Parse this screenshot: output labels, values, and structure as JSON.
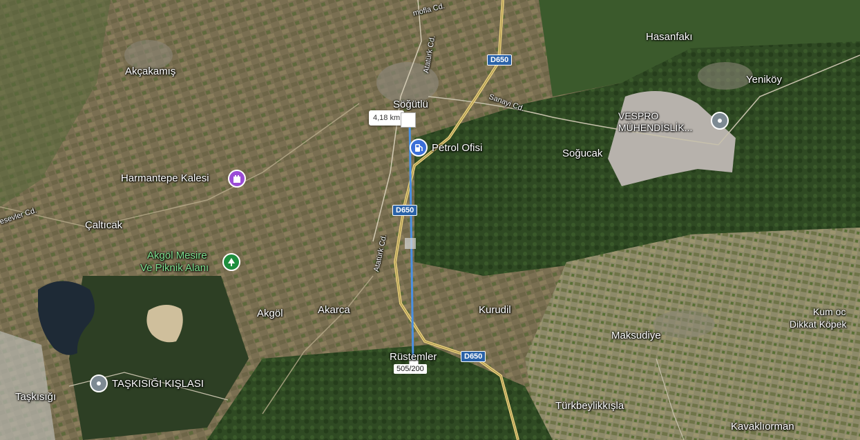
{
  "map": {
    "measurement": {
      "distance": "4,18 km"
    },
    "road_shields": [
      "D650",
      "D650",
      "D650"
    ],
    "pois": {
      "petrol": "Petrol Ofisi",
      "castle": "Harmantepe Kalesi",
      "park_line1": "Akgöl Mesire",
      "park_line2": "Ve Piknik Alanı",
      "vespro": "VESPRO MÜHENDİSLİK...",
      "taskisigi_kislasi": "TAŞKISIĞI KIŞLASI",
      "kum_line1": "Kum oc",
      "kum_line2": "Dikkat Köpek"
    },
    "places": {
      "akcakamis": "Akçakamış",
      "sogutlu": "Söğütlü",
      "hasanfaki": "Hasanfakı",
      "yenikoy": "Yeniköy",
      "sogucak": "Soğucak",
      "caltıcak": "Çaltıcak",
      "akgol": "Akgöl",
      "akarca": "Akarca",
      "kurudil": "Kurudil",
      "maksudiye": "Maksudiye",
      "rustemler": "Rüstemler",
      "taskisigi": "Taşkısığı",
      "turkbeylikkisla": "Türkbeylikkışla",
      "kavaklıorman": "Kavaklıorman"
    },
    "streets": {
      "ataturk1": "Atatürk Cd.",
      "ataturk2": "Atatürk Cd.",
      "sanayi": "Sanayi Cd.",
      "mofla": "mofla Cd.",
      "sevler": "esevler Cd."
    },
    "scale": "505/200",
    "icons": {
      "petrol": "fuel-pump-icon",
      "castle": "castle-icon",
      "park": "tree-icon",
      "vespro": "place-pin-icon",
      "kisla": "place-pin-icon"
    },
    "colors": {
      "measure_line": "#4a90e2",
      "petrol_pin": "#3a6fd8",
      "castle_pin": "#9b4cd6",
      "park_pin": "#1e8e3e",
      "generic_pin": "#7d8a93",
      "shield": "#2a62a7"
    }
  }
}
